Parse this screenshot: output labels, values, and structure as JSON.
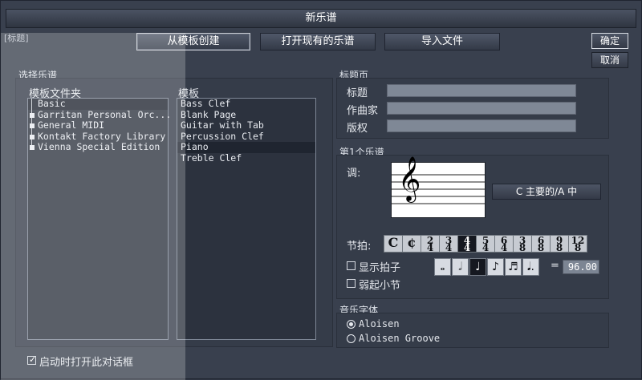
{
  "window": {
    "title": "新乐谱",
    "ghost_title": "[标题]"
  },
  "tabs": [
    {
      "label": "从模板创建",
      "active": true
    },
    {
      "label": "打开现有的乐谱",
      "active": false
    },
    {
      "label": "导入文件",
      "active": false
    }
  ],
  "buttons": {
    "ok": "确定",
    "cancel": "取消"
  },
  "choose_score": {
    "title": "选择乐谱",
    "folders_label": "模板文件夹",
    "templates_label": "模板",
    "folders": [
      {
        "label": "Basic",
        "selected": true,
        "expandable": false
      },
      {
        "label": "Garritan Personal Orc...",
        "selected": false,
        "expandable": true
      },
      {
        "label": "General MIDI",
        "selected": false,
        "expandable": true
      },
      {
        "label": "Kontakt Factory Library",
        "selected": false,
        "expandable": true
      },
      {
        "label": "Vienna Special Edition",
        "selected": false,
        "expandable": true
      }
    ],
    "templates": [
      {
        "label": "Bass Clef",
        "selected": false
      },
      {
        "label": "Blank Page",
        "selected": false
      },
      {
        "label": "Guitar with Tab",
        "selected": false
      },
      {
        "label": "Percussion Clef",
        "selected": false
      },
      {
        "label": "Piano",
        "selected": true
      },
      {
        "label": "Treble Clef",
        "selected": false
      }
    ],
    "startup_checkbox_label": "启动时打开此对话框",
    "startup_checked": true
  },
  "title_page": {
    "title": "标题页",
    "fields": [
      {
        "label": "标题",
        "value": ""
      },
      {
        "label": "作曲家",
        "value": ""
      },
      {
        "label": "版权",
        "value": ""
      }
    ]
  },
  "first_staff": {
    "title": "第1个乐谱",
    "key_label": "调:",
    "key_button": "C 主要的/A 中",
    "clef_glyph": "𝄞",
    "meter_label": "节拍:",
    "meters": [
      {
        "symbol": "C",
        "active": false
      },
      {
        "symbol": "¢",
        "active": false
      },
      {
        "top": "2",
        "bottom": "4",
        "active": false
      },
      {
        "top": "3",
        "bottom": "4",
        "active": false
      },
      {
        "top": "4",
        "bottom": "4",
        "active": true
      },
      {
        "top": "5",
        "bottom": "4",
        "active": false
      },
      {
        "top": "6",
        "bottom": "4",
        "active": false
      },
      {
        "top": "3",
        "bottom": "8",
        "active": false
      },
      {
        "top": "6",
        "bottom": "8",
        "active": false
      },
      {
        "top": "9",
        "bottom": "8",
        "active": false
      },
      {
        "top": "12",
        "bottom": "8",
        "active": false
      }
    ],
    "show_meter_label": "显示拍子",
    "show_meter_checked": false,
    "pickup_label": "弱起小节",
    "pickup_checked": false,
    "notes": [
      {
        "glyph": "𝅝",
        "active": false
      },
      {
        "glyph": "𝅗𝅥",
        "active": false
      },
      {
        "glyph": "♩",
        "active": true
      },
      {
        "glyph": "♪",
        "active": false
      },
      {
        "glyph": "♬",
        "active": false
      },
      {
        "glyph": "𝅘𝅥.",
        "active": false
      }
    ],
    "equals": "=",
    "tempo": "96.00"
  },
  "music_font": {
    "title": "音乐字体",
    "options": [
      {
        "label": "Aloisen",
        "selected": true
      },
      {
        "label": "Aloisen Groove",
        "selected": false
      }
    ]
  }
}
